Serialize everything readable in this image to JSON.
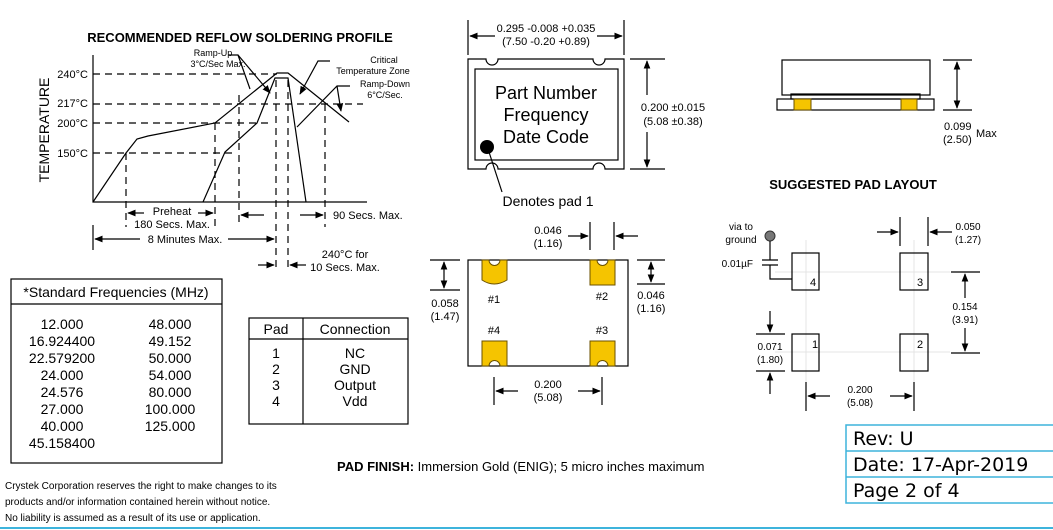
{
  "reflow": {
    "title": "RECOMMENDED REFLOW SOLDERING PROFILE",
    "y_axis_label": "TEMPERATURE",
    "temps": [
      "240°C",
      "217°C",
      "200°C",
      "150°C"
    ],
    "ramp_up": [
      "Ramp-Up",
      "3°C/Sec Max."
    ],
    "critical_zone": [
      "Critical",
      "Temperature Zone"
    ],
    "ramp_down": [
      "Ramp-Down",
      "6°C/Sec."
    ],
    "preheat": [
      "Preheat",
      "180 Secs. Max."
    ],
    "eight_min": "8 Minutes Max.",
    "ninety_sec": "90 Secs. Max.",
    "peak_hold": [
      "240°C for",
      "10 Secs. Max."
    ]
  },
  "package_top": {
    "width_dim": [
      "0.295 -0.008 +0.035",
      "(7.50 -0.20 +0.89)"
    ],
    "height_dim": [
      "0.200 ±0.015",
      "(5.08 ±0.38)"
    ],
    "marking": [
      "Part Number",
      "Frequency",
      "Date Code"
    ],
    "pad1_note": "Denotes pad 1"
  },
  "package_bottom": {
    "pad_labels": [
      "#1",
      "#2",
      "#3",
      "#4"
    ],
    "pad_width_dim": [
      "0.046",
      "(1.16)"
    ],
    "pad1_height_dim": [
      "0.058",
      "(1.47)"
    ],
    "pad2_height_dim": [
      "0.046",
      "(1.16)"
    ],
    "pitch_dim": [
      "0.200",
      "(5.08)"
    ],
    "pad_color": "#f5c400"
  },
  "side_view": {
    "height_dim": [
      "0.099",
      "(2.50)"
    ],
    "max_label": "Max"
  },
  "pad_layout": {
    "title": "SUGGESTED PAD LAYOUT",
    "via_label": [
      "via to",
      "ground"
    ],
    "cap_label": "0.01µF",
    "pad_numbers": [
      "1",
      "2",
      "3",
      "4"
    ],
    "pad_width_dim": [
      "0.050",
      "(1.27)"
    ],
    "row_pitch_dim": [
      "0.154",
      "(3.91)"
    ],
    "pad_height_dim": [
      "0.071",
      "(1.80)"
    ],
    "col_pitch_dim": [
      "0.200",
      "(5.08)"
    ]
  },
  "frequencies": {
    "title": "*Standard Frequencies (MHz)",
    "col1": [
      "12.000",
      "16.924400",
      "22.579200",
      "24.000",
      "24.576",
      "27.000",
      "40.000",
      "45.158400"
    ],
    "col2": [
      "48.000",
      "49.152",
      "50.000",
      "54.000",
      "80.000",
      "100.000",
      "125.000"
    ]
  },
  "pad_table": {
    "headers": [
      "Pad",
      "Connection"
    ],
    "rows": [
      {
        "pad": "1",
        "connection": "NC"
      },
      {
        "pad": "2",
        "connection": "GND"
      },
      {
        "pad": "3",
        "connection": "Output"
      },
      {
        "pad": "4",
        "connection": "Vdd"
      }
    ]
  },
  "pad_finish": {
    "label": "PAD FINISH:",
    "text": " Immersion Gold (ENIG); 5 micro inches maximum"
  },
  "disclaimer": [
    "Crystek Corporation reserves the right to make changes to its",
    "products and/or information contained herein without notice.",
    "No liability is assumed as a result of its use or application."
  ],
  "revision": {
    "rev": "Rev:  U",
    "date": "Date:  17-Apr-2019",
    "page": "Page 2 of 4"
  },
  "colors": {
    "border_accent": "#3db4dc",
    "pad_gold": "#f5c400"
  }
}
